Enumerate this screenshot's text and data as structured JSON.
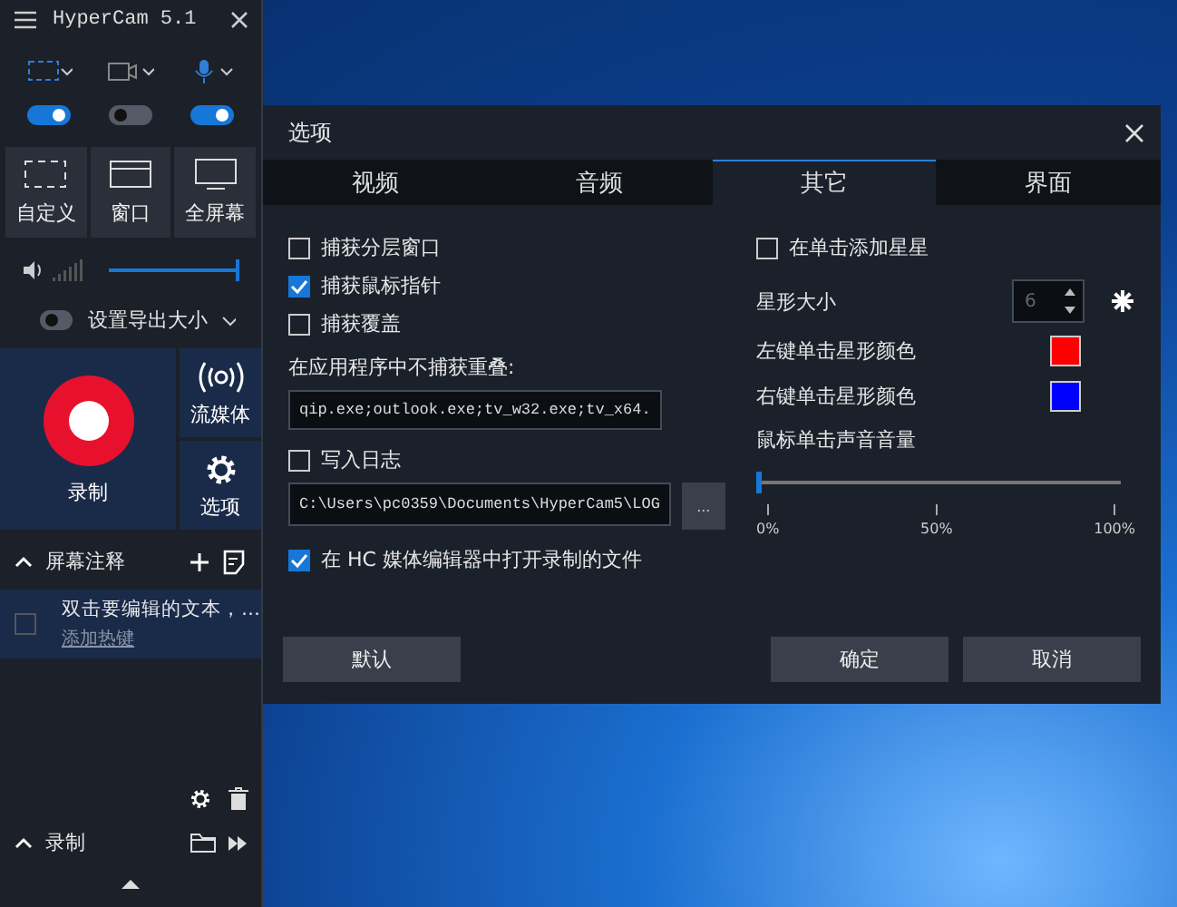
{
  "app_panel": {
    "title": "HyperCam 5.1",
    "sources": [
      {
        "kind": "area",
        "on": true
      },
      {
        "kind": "camera",
        "on": false
      },
      {
        "kind": "mic",
        "on": true
      }
    ],
    "capture_modes": [
      {
        "kind": "custom",
        "label": "自定义"
      },
      {
        "kind": "window",
        "label": "窗口"
      },
      {
        "kind": "fullscreen",
        "label": "全屏幕"
      }
    ],
    "volume": {
      "level": 1
    },
    "output_size": {
      "label": "设置导出大小",
      "on": false
    },
    "record_button": {
      "label": "录制"
    },
    "side_buttons": [
      {
        "kind": "stream",
        "label": "流媒体"
      },
      {
        "kind": "options",
        "label": "选项"
      }
    ],
    "annotations": {
      "title": "屏幕注释",
      "expanded": true,
      "items": [
        {
          "text": "双击要编辑的文本，…",
          "hotkey": "添加热键",
          "checked": false
        }
      ]
    },
    "recordings": {
      "title": "录制",
      "expanded": true
    }
  },
  "dialog": {
    "title": "选项",
    "tabs": [
      {
        "label": "视频",
        "selected": false
      },
      {
        "label": "音频",
        "selected": false
      },
      {
        "label": "其它",
        "selected": true
      },
      {
        "label": "界面",
        "selected": false
      }
    ],
    "left_options": [
      {
        "label": "捕获分层窗口",
        "checked": false
      },
      {
        "label": "捕获鼠标指针",
        "checked": true
      },
      {
        "label": "捕获覆盖",
        "checked": false
      }
    ],
    "exclude": {
      "label": "在应用程序中不捕获重叠:",
      "value": "qip.exe;outlook.exe;tv_w32.exe;tv_x64."
    },
    "log": {
      "label": "写入日志",
      "checked": false,
      "path": "C:\\Users\\pc0359\\Documents\\HyperCam5\\LOG",
      "browse": "..."
    },
    "open_in_editor": {
      "label": "在 HC 媒体编辑器中打开录制的文件",
      "checked": true
    },
    "add_stars": {
      "label": "在单击添加星星",
      "checked": false
    },
    "star_size": {
      "label": "星形大小",
      "value": "6"
    },
    "star_colors": [
      {
        "label": "左键单击星形颜色",
        "color": "#ff0000"
      },
      {
        "label": "右键单击星形颜色",
        "color": "#0000ff"
      }
    ],
    "click_volume": {
      "label": "鼠标单击声音音量",
      "level": 0,
      "ticks": [
        "0%",
        "50%",
        "100%"
      ]
    },
    "buttons": [
      {
        "kind": "default",
        "label": "默认"
      },
      {
        "kind": "ok",
        "label": "确定"
      },
      {
        "kind": "cancel",
        "label": "取消"
      }
    ]
  }
}
